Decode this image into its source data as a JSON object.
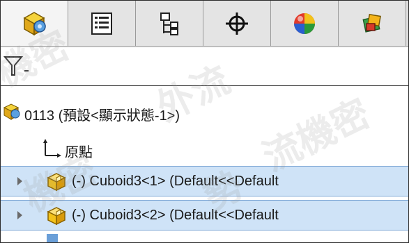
{
  "tabs": [
    {
      "icon": "assembly-icon",
      "active": true
    },
    {
      "icon": "property-manager-icon",
      "active": false
    },
    {
      "icon": "configuration-manager-icon",
      "active": false
    },
    {
      "icon": "dimxpert-icon",
      "active": false
    },
    {
      "icon": "display-manager-icon",
      "active": false
    },
    {
      "icon": "cam-icon",
      "active": false
    }
  ],
  "filter": {
    "icon": "filter-icon"
  },
  "tree": {
    "root": {
      "label": "0113  (預設<顯示狀態-1>)",
      "icon": "assembly-icon"
    },
    "origin": {
      "label": "原點",
      "icon": "origin-icon"
    },
    "components": [
      {
        "label": "(-) Cuboid3<1> (Default<<Default",
        "icon": "part-icon",
        "selected": true
      },
      {
        "label": "(-) Cuboid3<2> (Default<<Default",
        "icon": "part-icon",
        "selected": true
      }
    ]
  },
  "watermark": {
    "text": "機密 外流 勢 流機密"
  },
  "colors": {
    "selection": "#cfe3f7",
    "selection_border": "#7fa8d6",
    "part_yellow": "#f3c21a"
  }
}
